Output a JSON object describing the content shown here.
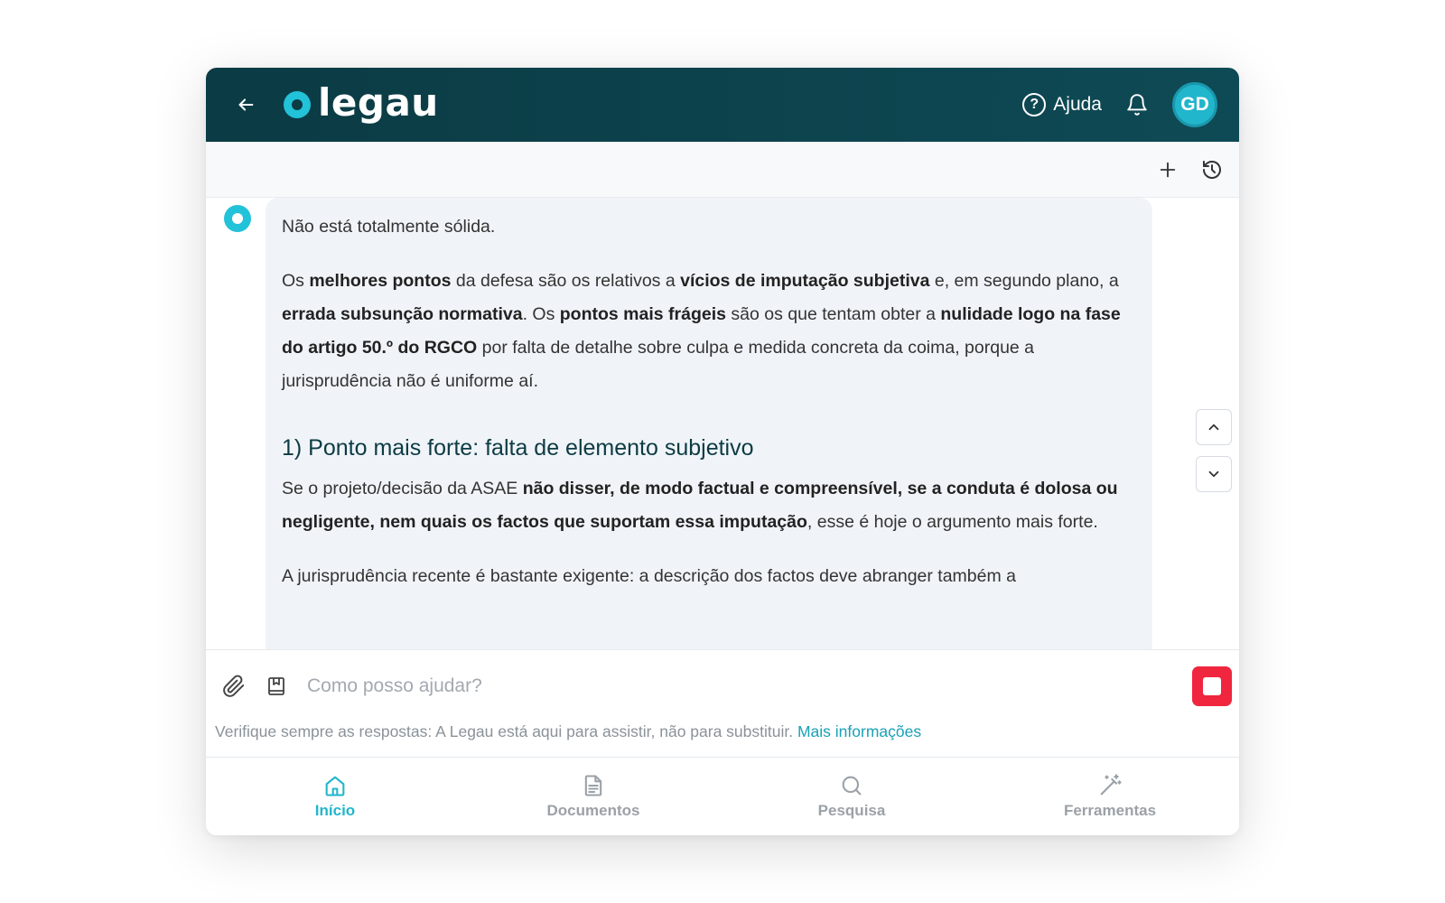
{
  "header": {
    "logo_text": "legau",
    "help_label": "Ajuda",
    "avatar_initials": "GD"
  },
  "toolbar": {
    "new_chat_icon": "plus-icon",
    "history_icon": "history-icon"
  },
  "message": {
    "intro": "Não está totalmente sólida.",
    "p1": [
      {
        "t": "Os ",
        "b": false
      },
      {
        "t": "melhores pontos",
        "b": true
      },
      {
        "t": " da defesa são os relativos a ",
        "b": false
      },
      {
        "t": "vícios de imputação subjetiva",
        "b": true
      },
      {
        "t": " e, em segundo plano, a ",
        "b": false
      },
      {
        "t": "errada subsunção normativa",
        "b": true
      },
      {
        "t": ". Os ",
        "b": false
      },
      {
        "t": "pontos mais frágeis",
        "b": true
      },
      {
        "t": " são os que tentam obter a ",
        "b": false
      },
      {
        "t": "nulidade logo na fase do artigo 50.º do RGCO",
        "b": true
      },
      {
        "t": " por falta de detalhe sobre culpa e medida concreta da coima, porque a jurisprudência não é uniforme aí.",
        "b": false
      }
    ],
    "heading": "1) Ponto mais forte: falta de elemento subjetivo",
    "p2": [
      {
        "t": "Se o projeto/decisão da ASAE ",
        "b": false
      },
      {
        "t": "não disser, de modo factual e compreensível, se a conduta é dolosa ou negligente, nem quais os factos que suportam essa imputação",
        "b": true
      },
      {
        "t": ", esse é hoje o argumento mais forte.",
        "b": false
      }
    ],
    "p3": "A jurisprudência recente é bastante exigente: a descrição dos factos deve abranger também a"
  },
  "composer": {
    "placeholder": "Como posso ajudar?",
    "disclaimer": "Verifique sempre as respostas: A Legau está aqui para assistir, não para substituir.",
    "more_info": "Mais informações"
  },
  "nav": {
    "items": [
      {
        "label": "Início",
        "icon": "home-icon",
        "active": true
      },
      {
        "label": "Documentos",
        "icon": "document-icon",
        "active": false
      },
      {
        "label": "Pesquisa",
        "icon": "search-icon",
        "active": false
      },
      {
        "label": "Ferramentas",
        "icon": "magic-wand-icon",
        "active": false
      }
    ]
  },
  "colors": {
    "header_bg": "#0b3b44",
    "accent": "#22c2d8",
    "stop": "#f0263f"
  }
}
